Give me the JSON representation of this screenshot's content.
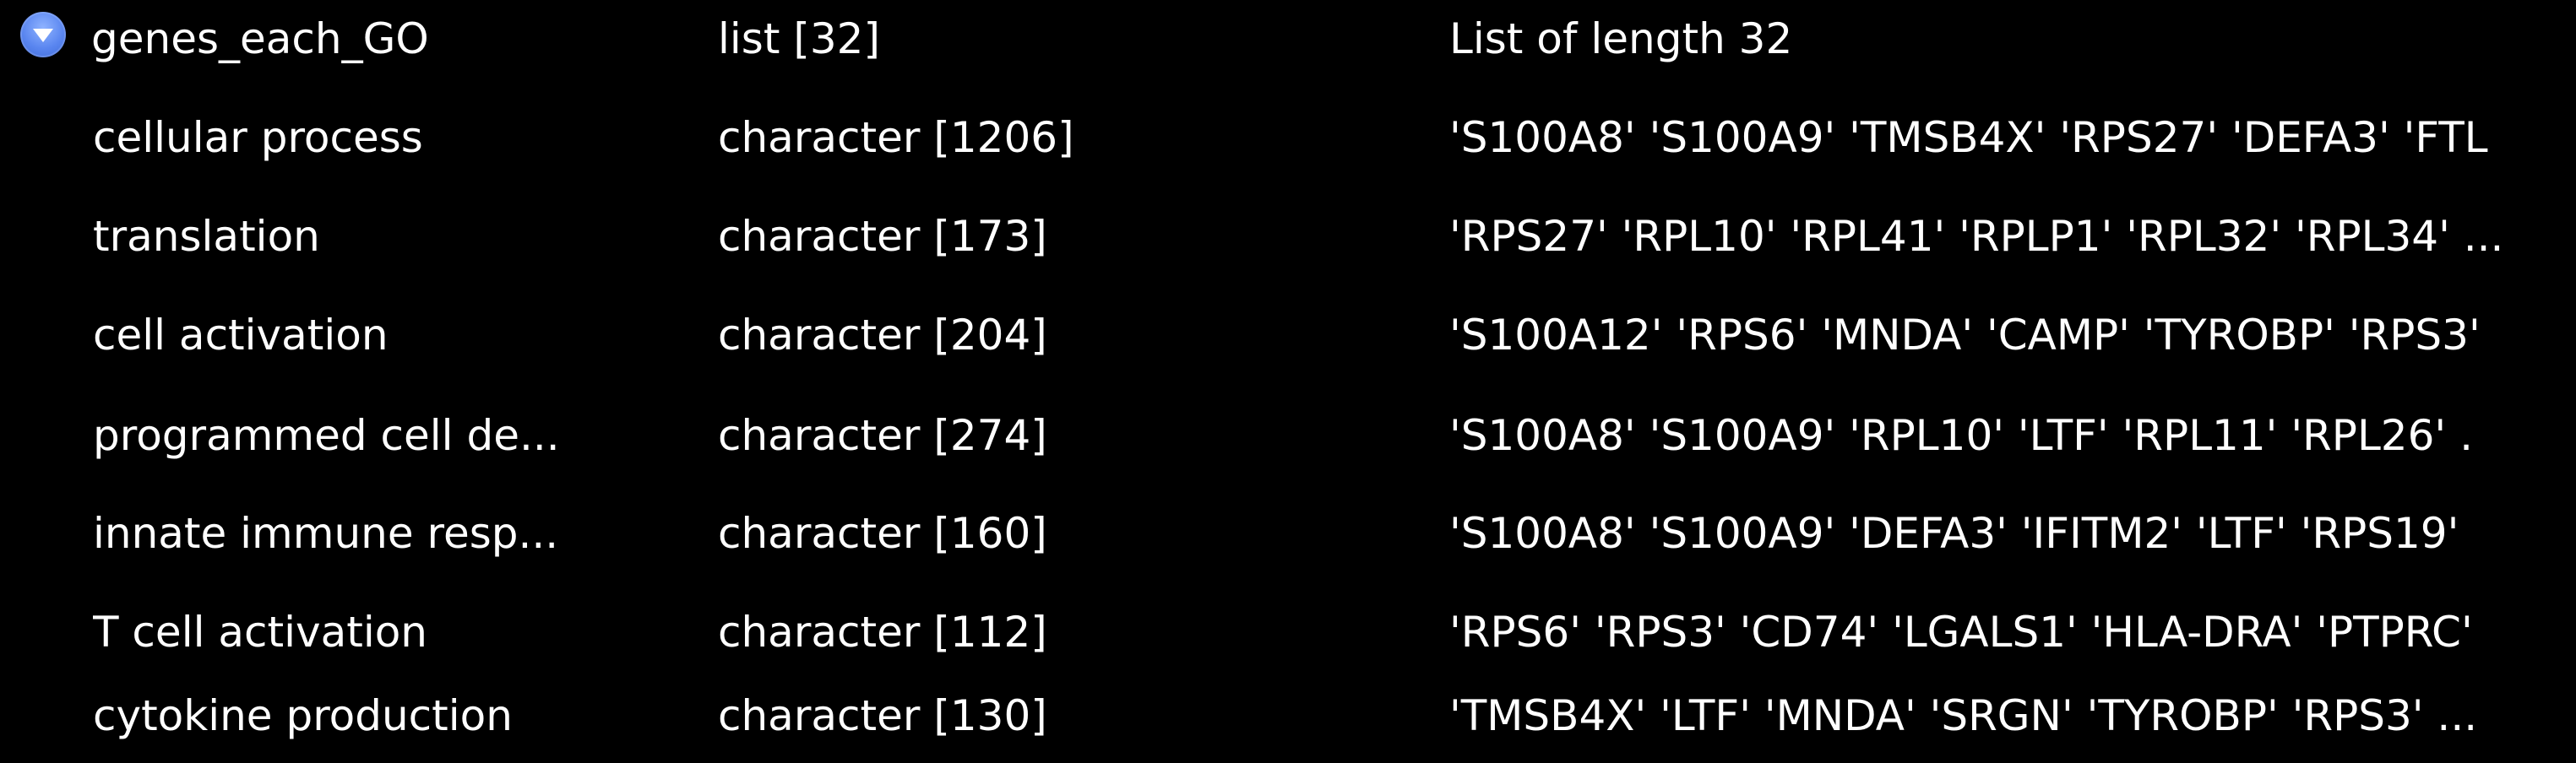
{
  "environment": {
    "parent": {
      "toggle_icon": "disclosure-chevron-down-icon",
      "name": "genes_each_GO",
      "type": "list [32]",
      "value": "List of length 32"
    },
    "children": [
      {
        "name": "cellular process",
        "type": "character [1206]",
        "value": "'S100A8' 'S100A9' 'TMSB4X' 'RPS27' 'DEFA3' 'FTL"
      },
      {
        "name": "translation",
        "type": "character [173]",
        "value": "'RPS27' 'RPL10' 'RPL41' 'RPLP1' 'RPL32' 'RPL34' ..."
      },
      {
        "name": "cell activation",
        "type": "character [204]",
        "value": "'S100A12' 'RPS6' 'MNDA' 'CAMP' 'TYROBP' 'RPS3'"
      },
      {
        "name": "programmed cell de...",
        "type": "character [274]",
        "value": "'S100A8' 'S100A9' 'RPL10' 'LTF' 'RPL11' 'RPL26' ."
      },
      {
        "name": "innate immune resp...",
        "type": "character [160]",
        "value": "'S100A8' 'S100A9' 'DEFA3' 'IFITM2' 'LTF' 'RPS19'"
      },
      {
        "name": "T cell activation",
        "type": "character [112]",
        "value": "'RPS6' 'RPS3' 'CD74' 'LGALS1' 'HLA-DRA' 'PTPRC'"
      },
      {
        "name": "cytokine production",
        "type": "character [130]",
        "value": "'TMSB4X' 'LTF' 'MNDA' 'SRGN' 'TYROBP' 'RPS3' ..."
      }
    ]
  },
  "colors": {
    "background": "#000000",
    "text": "#ffffff",
    "toggle_fill": "#5a86f0"
  }
}
